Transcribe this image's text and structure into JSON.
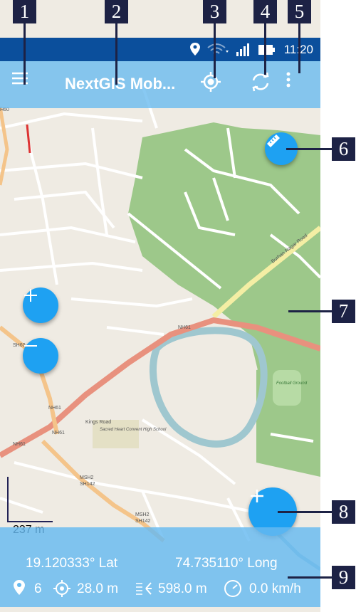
{
  "status_bar": {
    "time": "11:20",
    "icons": [
      "location-icon",
      "wifi-icon",
      "signal-icon",
      "battery-icon"
    ]
  },
  "app_bar": {
    "title": "NextGIS Mob...",
    "icons": [
      "menu-icon",
      "my-location-icon",
      "sync-icon",
      "more-vert-icon"
    ]
  },
  "map": {
    "road_labels": [
      "NH61",
      "NH61",
      "NH61",
      "NH61",
      "SH60",
      "H60",
      "Kings Road",
      "MSH2",
      "SH142",
      "MSH2",
      "SH142",
      "Burhan Nagar Road"
    ],
    "place_labels": [
      "Sacred Heart Convent High School",
      "Football Ground"
    ],
    "scale_label": "237 m"
  },
  "info_bar": {
    "latitude": "19.120333° Lat",
    "longitude": "74.735110° Long",
    "satellites": "6",
    "accuracy": "28.0 m",
    "altitude": "598.0 m",
    "speed": "0.0 km/h"
  },
  "callouts": [
    "1",
    "2",
    "3",
    "4",
    "5",
    "6",
    "7",
    "8",
    "9"
  ],
  "colors": {
    "status_bar": "#0b4f9c",
    "app_bar": "#66baf0",
    "fab": "#1ea1f2",
    "forest": "#9dc88a",
    "callout": "#1d2245"
  }
}
